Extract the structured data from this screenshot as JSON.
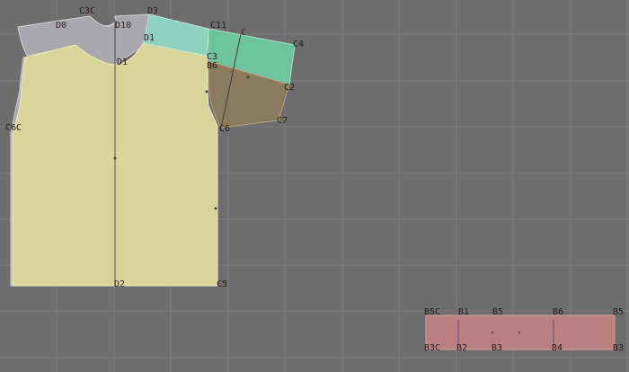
{
  "app": {
    "view": "pattern-layout-2d"
  },
  "colors": {
    "background": "#6d6d6d",
    "grid": "#7b7b7b",
    "body_piece": "#d9d59a",
    "back_piece": "#a9a9ad",
    "shoulder_piece": "#8fd0bf",
    "sleeve_top": "#6cc39d",
    "sleeve_bottom": "#8a7a5e",
    "band_piece": "#b98080",
    "point_label": "#2a1a1a"
  },
  "points": {
    "p_c3c": "C3C",
    "p_d3": "D3",
    "p_d0": "D0",
    "p_d10": "D10",
    "p_c11": "C11",
    "p_c": "C",
    "p_c4": "C4",
    "p_d1_top": "D1",
    "p_c3": "C3",
    "p_b6_s": "B6",
    "p_c2": "C2",
    "p_c7": "C7",
    "p_c6": "C6",
    "p_d1": "D1",
    "p_c6c": "C6C",
    "p_d2": "D2",
    "p_c5": "C5"
  },
  "band": {
    "top": [
      "B5C",
      "B1",
      "B5",
      "B6",
      "B5"
    ],
    "bottom": [
      "B3C",
      "B2",
      "B3",
      "B4",
      "B3"
    ]
  }
}
